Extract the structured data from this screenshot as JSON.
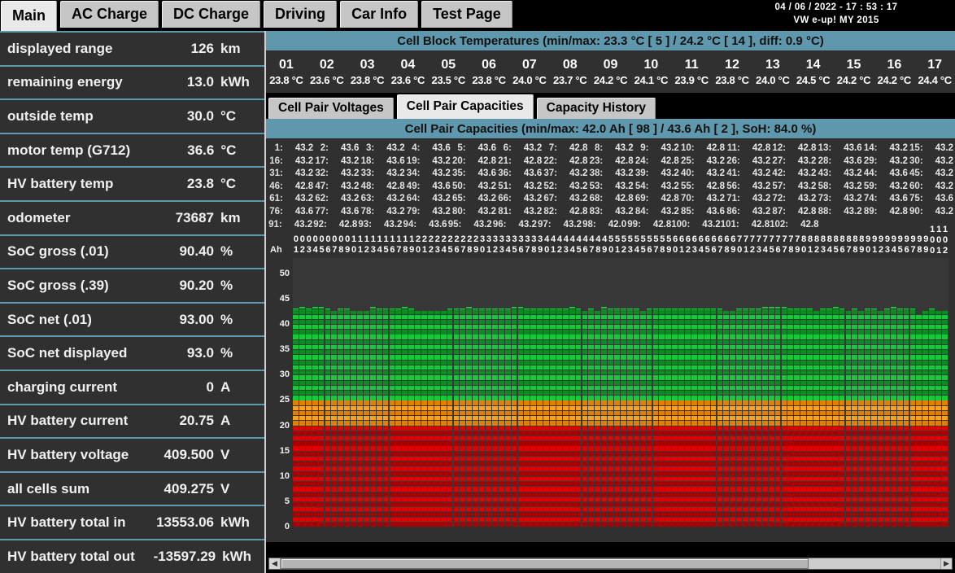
{
  "header": {
    "tabs": [
      {
        "label": "Main",
        "active": true
      },
      {
        "label": "AC Charge",
        "active": false
      },
      {
        "label": "DC Charge",
        "active": false
      },
      {
        "label": "Driving",
        "active": false
      },
      {
        "label": "Car Info",
        "active": false
      },
      {
        "label": "Test Page",
        "active": false
      }
    ],
    "datetime": "04 / 06 / 2022  -  17 : 53 : 17",
    "vehicle": "VW e-up! MY 2015"
  },
  "left_panel": {
    "rows": [
      {
        "label": "displayed range",
        "value": "126",
        "unit": "km"
      },
      {
        "label": "remaining energy",
        "value": "13.0",
        "unit": "kWh"
      },
      {
        "label": "outside temp",
        "value": "30.0",
        "unit": "°C"
      },
      {
        "label": "motor temp (G712)",
        "value": "36.6",
        "unit": "°C"
      },
      {
        "label": "HV battery temp",
        "value": "23.8",
        "unit": "°C"
      },
      {
        "label": "odometer",
        "value": "73687",
        "unit": "km"
      },
      {
        "label": "SoC gross (.01)",
        "value": "90.40",
        "unit": "%"
      },
      {
        "label": "SoC gross (.39)",
        "value": "90.20",
        "unit": "%"
      },
      {
        "label": "SoC net (.01)",
        "value": "93.00",
        "unit": "%"
      },
      {
        "label": "SoC net displayed",
        "value": "93.0",
        "unit": "%"
      },
      {
        "label": "charging current",
        "value": "0",
        "unit": "A"
      },
      {
        "label": "HV battery current",
        "value": "20.75",
        "unit": "A"
      },
      {
        "label": "HV battery voltage",
        "value": "409.500",
        "unit": "V"
      },
      {
        "label": "all cells sum",
        "value": "409.275",
        "unit": "V"
      },
      {
        "label": "HV battery total in",
        "value": "13553.06",
        "unit": "kWh"
      },
      {
        "label": "HV battery total out",
        "value": "-13597.29",
        "unit": "kWh"
      }
    ]
  },
  "temperatures": {
    "banner": "Cell Block Temperatures (min/max:  23.3 °C [ 5 ] /  24.2 °C [ 14 ],  diff:  0.9 °C)",
    "indices": [
      "01",
      "02",
      "03",
      "04",
      "05",
      "06",
      "07",
      "08",
      "09",
      "10",
      "11",
      "12",
      "13",
      "14",
      "15",
      "16",
      "17"
    ],
    "values": [
      "23.8 °C",
      "23.6 °C",
      "23.8 °C",
      "23.6 °C",
      "23.5 °C",
      "23.8 °C",
      "24.0 °C",
      "23.7 °C",
      "24.2 °C",
      "24.1 °C",
      "23.9 °C",
      "23.8 °C",
      "24.0 °C",
      "24.5 °C",
      "24.2 °C",
      "24.2 °C",
      "24.4 °C"
    ]
  },
  "subtabs": [
    {
      "label": "Cell Pair Voltages",
      "active": false
    },
    {
      "label": "Cell Pair Capacities",
      "active": true
    },
    {
      "label": "Capacity History",
      "active": false
    }
  ],
  "capacities": {
    "banner": "Cell Pair Capacities (min/max:  42.0 Ah [ 98 ] /  43.6 Ah [ 2 ],  SoH:  84.0 %)",
    "unit_label": "Ah",
    "min": 42.0,
    "min_index": 98,
    "max": 43.6,
    "max_index": 2,
    "soh": "84.0 %",
    "values": [
      43.2,
      43.6,
      43.2,
      43.6,
      43.6,
      43.2,
      42.8,
      43.2,
      43.2,
      42.8,
      42.8,
      42.8,
      43.6,
      43.2,
      43.2,
      43.2,
      43.2,
      43.6,
      43.2,
      42.8,
      42.8,
      42.8,
      42.8,
      42.8,
      43.2,
      43.2,
      43.2,
      43.6,
      43.2,
      43.2,
      43.2,
      43.2,
      43.2,
      43.2,
      43.6,
      43.6,
      43.2,
      43.2,
      43.2,
      43.2,
      43.2,
      43.2,
      43.2,
      43.6,
      43.2,
      42.8,
      43.2,
      42.8,
      43.6,
      43.2,
      43.2,
      43.2,
      43.2,
      43.2,
      42.8,
      43.2,
      43.2,
      43.2,
      43.2,
      43.2,
      43.2,
      43.2,
      43.2,
      43.2,
      43.2,
      43.2,
      43.2,
      42.8,
      42.8,
      43.2,
      43.2,
      43.2,
      43.2,
      43.6,
      43.6,
      43.6,
      43.6,
      43.2,
      43.2,
      43.2,
      43.2,
      42.8,
      43.2,
      43.2,
      43.6,
      43.2,
      42.8,
      43.2,
      42.8,
      43.2,
      43.2,
      42.8,
      43.2,
      43.6,
      43.2,
      43.2,
      43.2,
      42.0,
      42.8,
      43.2,
      42.8,
      42.8
    ]
  },
  "chart_data": {
    "type": "bar",
    "title": "Cell Pair Capacities",
    "xlabel": "Ah",
    "ylabel": "",
    "ylim": [
      0,
      53
    ],
    "yticks": [
      0,
      5,
      10,
      15,
      20,
      25,
      30,
      35,
      40,
      45,
      50
    ],
    "grid": true,
    "categories": [
      "1",
      "2",
      "3",
      "4",
      "5",
      "6",
      "7",
      "8",
      "9",
      "10",
      "11",
      "12",
      "13",
      "14",
      "15",
      "16",
      "17",
      "18",
      "19",
      "20",
      "21",
      "22",
      "23",
      "24",
      "25",
      "26",
      "27",
      "28",
      "29",
      "30",
      "31",
      "32",
      "33",
      "34",
      "35",
      "36",
      "37",
      "38",
      "39",
      "40",
      "41",
      "42",
      "43",
      "44",
      "45",
      "46",
      "47",
      "48",
      "49",
      "50",
      "51",
      "52",
      "53",
      "54",
      "55",
      "56",
      "57",
      "58",
      "59",
      "60",
      "61",
      "62",
      "63",
      "64",
      "65",
      "66",
      "67",
      "68",
      "69",
      "70",
      "71",
      "72",
      "73",
      "74",
      "75",
      "76",
      "77",
      "78",
      "79",
      "80",
      "81",
      "82",
      "83",
      "84",
      "85",
      "86",
      "87",
      "88",
      "89",
      "90",
      "91",
      "92",
      "93",
      "94",
      "95",
      "96",
      "97",
      "98",
      "99",
      "100",
      "101",
      "102"
    ],
    "values": [
      43.2,
      43.6,
      43.2,
      43.6,
      43.6,
      43.2,
      42.8,
      43.2,
      43.2,
      42.8,
      42.8,
      42.8,
      43.6,
      43.2,
      43.2,
      43.2,
      43.2,
      43.6,
      43.2,
      42.8,
      42.8,
      42.8,
      42.8,
      42.8,
      43.2,
      43.2,
      43.2,
      43.6,
      43.2,
      43.2,
      43.2,
      43.2,
      43.2,
      43.2,
      43.6,
      43.6,
      43.2,
      43.2,
      43.2,
      43.2,
      43.2,
      43.2,
      43.2,
      43.6,
      43.2,
      42.8,
      43.2,
      42.8,
      43.6,
      43.2,
      43.2,
      43.2,
      43.2,
      43.2,
      42.8,
      43.2,
      43.2,
      43.2,
      43.2,
      43.2,
      43.2,
      43.2,
      43.2,
      43.2,
      43.2,
      43.2,
      43.2,
      42.8,
      42.8,
      43.2,
      43.2,
      43.2,
      43.2,
      43.6,
      43.6,
      43.6,
      43.6,
      43.2,
      43.2,
      43.2,
      43.2,
      42.8,
      43.2,
      43.2,
      43.6,
      43.2,
      42.8,
      43.2,
      42.8,
      43.2,
      43.2,
      42.8,
      43.2,
      43.6,
      43.2,
      43.2,
      43.2,
      42.0,
      42.8,
      43.2,
      42.8,
      42.8
    ],
    "colors": {
      "red": "#e00000",
      "red_dark": "#a60000",
      "orange": "#ffa11a",
      "orange_dark": "#e08000",
      "green": "#16c93c",
      "green_dark": "#0c8a24",
      "plot_bg": "#383838",
      "banner": "#5f97ac"
    },
    "zones": [
      {
        "from": 0,
        "to": 20,
        "color": "red"
      },
      {
        "from": 20,
        "to": 25,
        "color": "orange"
      },
      {
        "from": 25,
        "to": 43.6,
        "color": "green"
      }
    ]
  },
  "scrollbar": {
    "left_arrow": "◀",
    "right_arrow": "▶",
    "thumb_percent": 80
  }
}
